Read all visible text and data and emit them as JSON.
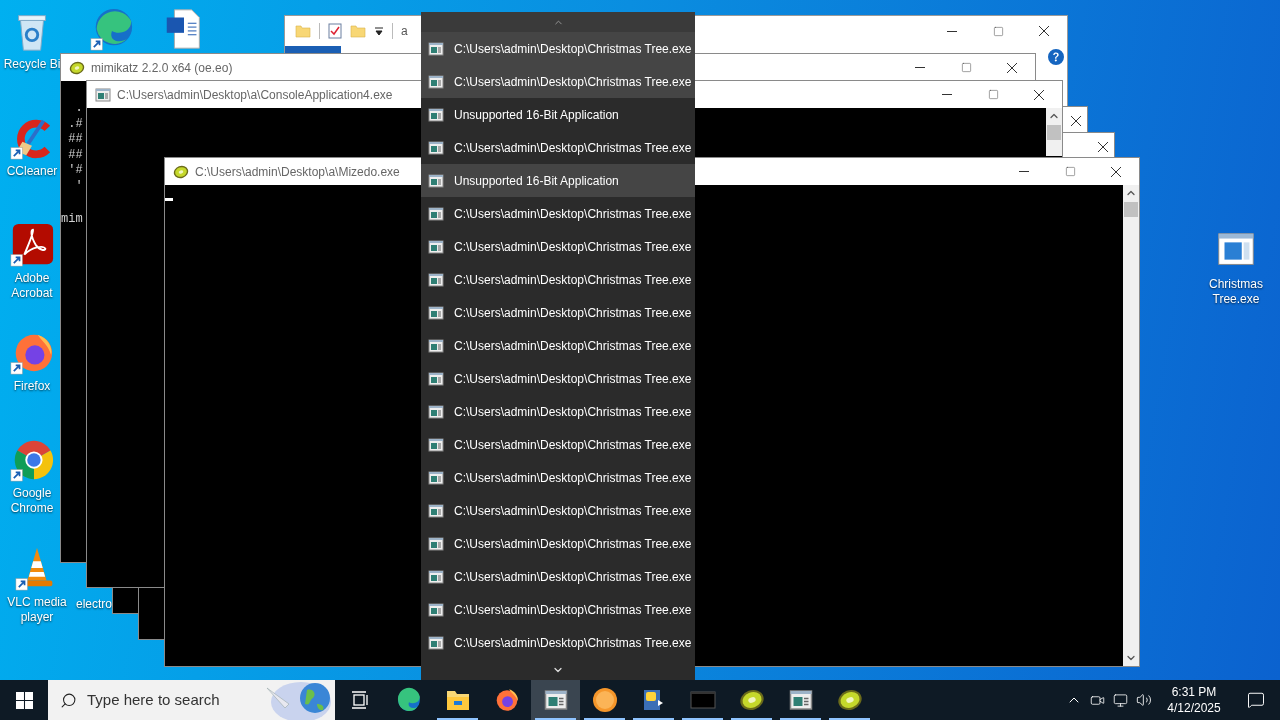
{
  "desktop_icons": [
    {
      "label": "Recycle Bi",
      "kind": "recycle_bin"
    },
    {
      "kind": "edge"
    },
    {
      "kind": "word"
    },
    {
      "label": "CCleaner",
      "kind": "ccleaner"
    },
    {
      "label": "Adobe Acrobat",
      "kind": "acrobat"
    },
    {
      "label": "Firefox",
      "kind": "firefox"
    },
    {
      "label": "Google Chrome",
      "kind": "chrome"
    },
    {
      "label": "VLC media player",
      "kind": "vlc"
    },
    {
      "label": "electro"
    },
    {
      "label": "Christmas Tree.exe",
      "kind": "program"
    }
  ],
  "windows": [
    {
      "kind": "explorer",
      "title": "a"
    },
    {
      "kind": "kiwi_console",
      "title": "mimikatz 2.2.0 x64 (oe.eo)",
      "console_lines": [
        "  .",
        " .#",
        " ##",
        " ##",
        " '#",
        "  '"
      ],
      "prompt_line": "mim"
    },
    {
      "kind": "console",
      "title": "C:\\Users\\admin\\Desktop\\a\\ConsoleApplication4.exe"
    },
    {
      "kind": "console"
    },
    {
      "kind": "console"
    },
    {
      "kind": "kiwi_console",
      "title": "C:\\Users\\admin\\Desktop\\a\\Mizedo.exe",
      "cursor": true
    }
  ],
  "jump_list": {
    "items": [
      {
        "label": "C:\\Users\\admin\\Desktop\\Christmas Tree.exe",
        "selected": true
      },
      {
        "label": "C:\\Users\\admin\\Desktop\\Christmas Tree.exe",
        "selected": true
      },
      {
        "label": "Unsupported 16-Bit Application",
        "selected": false
      },
      {
        "label": "C:\\Users\\admin\\Desktop\\Christmas Tree.exe",
        "selected": false
      },
      {
        "label": "Unsupported 16-Bit Application",
        "selected": true
      },
      {
        "label": "C:\\Users\\admin\\Desktop\\Christmas Tree.exe",
        "selected": false
      },
      {
        "label": "C:\\Users\\admin\\Desktop\\Christmas Tree.exe",
        "selected": false
      },
      {
        "label": "C:\\Users\\admin\\Desktop\\Christmas Tree.exe",
        "selected": false
      },
      {
        "label": "C:\\Users\\admin\\Desktop\\Christmas Tree.exe",
        "selected": false
      },
      {
        "label": "C:\\Users\\admin\\Desktop\\Christmas Tree.exe",
        "selected": false
      },
      {
        "label": "C:\\Users\\admin\\Desktop\\Christmas Tree.exe",
        "selected": false
      },
      {
        "label": "C:\\Users\\admin\\Desktop\\Christmas Tree.exe",
        "selected": false
      },
      {
        "label": "C:\\Users\\admin\\Desktop\\Christmas Tree.exe",
        "selected": false
      },
      {
        "label": "C:\\Users\\admin\\Desktop\\Christmas Tree.exe",
        "selected": false
      },
      {
        "label": "C:\\Users\\admin\\Desktop\\Christmas Tree.exe",
        "selected": false
      },
      {
        "label": "C:\\Users\\admin\\Desktop\\Christmas Tree.exe",
        "selected": false
      },
      {
        "label": "C:\\Users\\admin\\Desktop\\Christmas Tree.exe",
        "selected": false
      },
      {
        "label": "C:\\Users\\admin\\Desktop\\Christmas Tree.exe",
        "selected": false
      },
      {
        "label": "C:\\Users\\admin\\Desktop\\Christmas Tree.exe",
        "selected": false
      }
    ]
  },
  "taskbar": {
    "search": {
      "placeholder": "Type here to search"
    },
    "apps": [
      {
        "kind": "task_view",
        "running": false,
        "selected": false
      },
      {
        "kind": "edge",
        "running": false,
        "selected": false
      },
      {
        "kind": "explorer",
        "running": true,
        "selected": false
      },
      {
        "kind": "firefox",
        "running": false,
        "selected": false
      },
      {
        "kind": "console",
        "running": true,
        "selected": true
      },
      {
        "kind": "orange",
        "running": true,
        "selected": false
      },
      {
        "kind": "python",
        "running": true,
        "selected": false
      },
      {
        "kind": "black_window",
        "running": true,
        "selected": false
      },
      {
        "kind": "kiwi",
        "running": true,
        "selected": false
      },
      {
        "kind": "console",
        "running": true,
        "selected": false
      },
      {
        "kind": "kiwi",
        "running": true,
        "selected": false
      }
    ],
    "clock": {
      "time": "6:31 PM",
      "date": "4/12/2025"
    }
  }
}
